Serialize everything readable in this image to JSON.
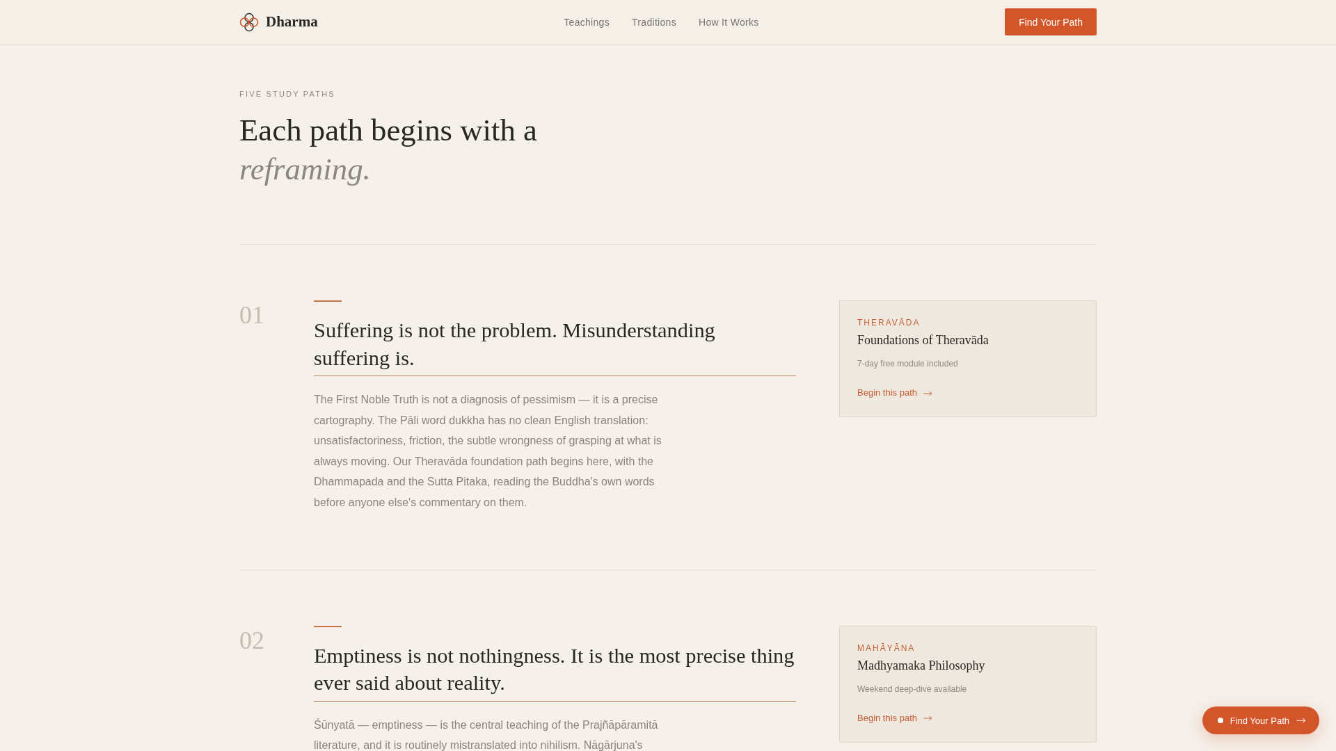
{
  "nav": {
    "brand": "Dharma",
    "links": [
      "Teachings",
      "Traditions",
      "How It Works"
    ],
    "cta": "Find Your Path"
  },
  "hero": {
    "eyebrow": "FIVE STUDY PATHS",
    "heading": "Each path begins with a *reframing.*"
  },
  "paths": [
    {
      "number": "01",
      "title": "Suffering is not the problem. Misunderstanding suffering is.",
      "body": "The First Noble Truth is not a diagnosis of pessimism — it is a precise cartography. The Pāli word dukkha has no clean English translation: unsatisfactoriness, friction, the subtle wrongness of grasping at what is always moving. Our Theravāda foundation path begins here, with the Dhammapada and the Sutta Pitaka, reading the Buddha's own words before anyone else's commentary on them.",
      "card": {
        "tradition": "THERAVĀDA",
        "title": "Foundations of Theravāda",
        "note": "7-day free module included",
        "link": "Begin this path"
      }
    },
    {
      "number": "02",
      "title": "Emptiness is not nothingness. It is the most precise thing ever said about reality.",
      "body": "Śūnyatā — emptiness — is the central teaching of the Prajñāpāramitā literature, and it is routinely mistranslated into nihilism. Nāgārjuna's",
      "card": {
        "tradition": "MAHĀYĀNA",
        "title": "Madhyamaka Philosophy",
        "note": "Weekend deep-dive available",
        "link": "Begin this path"
      }
    }
  ],
  "floating_button": {
    "label": "Find Your Path"
  }
}
